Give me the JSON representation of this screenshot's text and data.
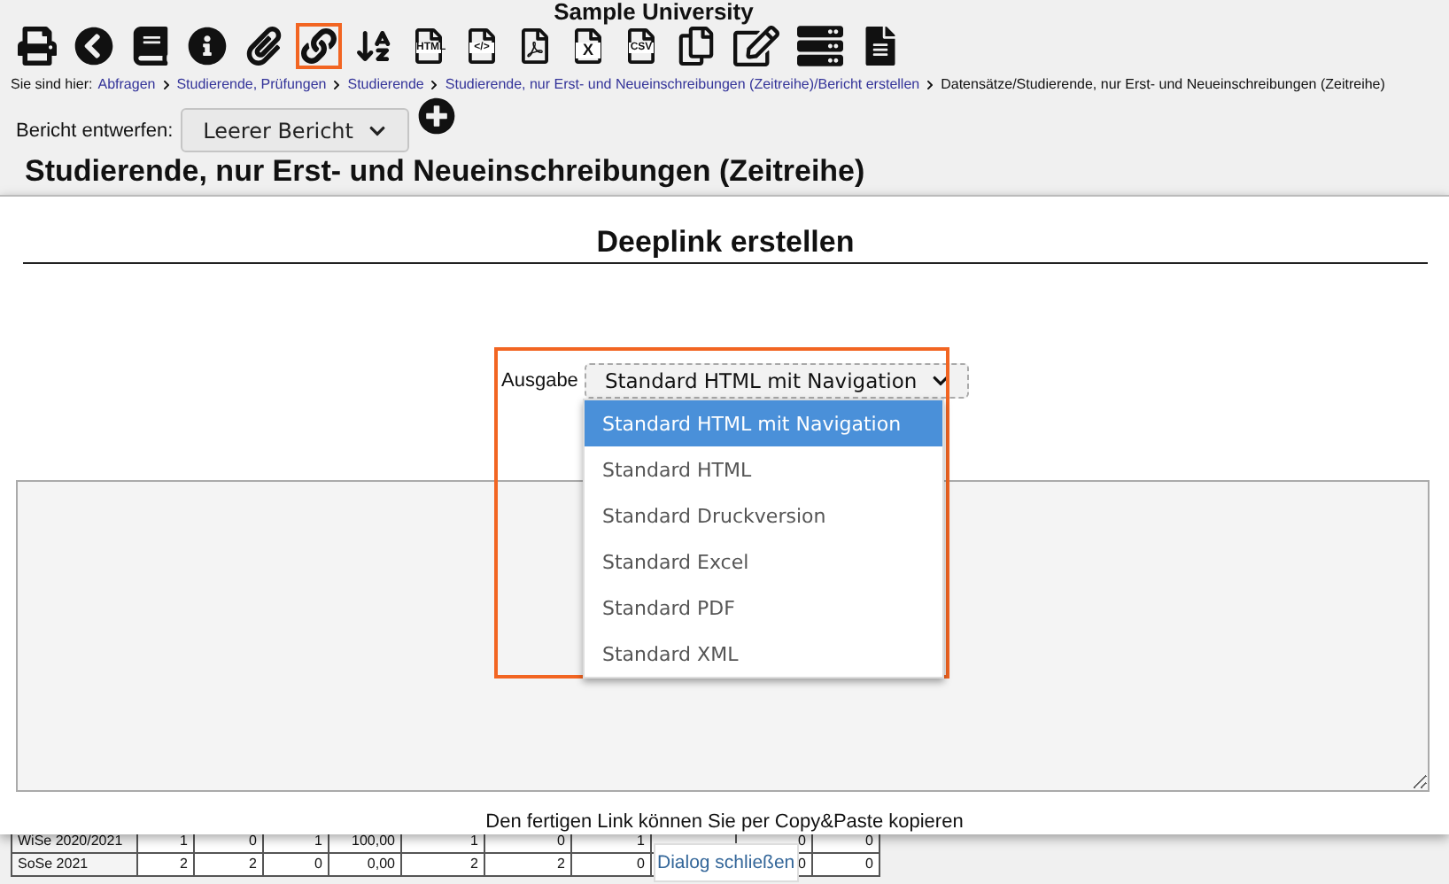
{
  "header": {
    "title": "Sample University"
  },
  "toolbar": [
    {
      "kind": "print",
      "highlighted": false
    },
    {
      "kind": "back",
      "highlighted": false
    },
    {
      "kind": "book",
      "highlighted": false
    },
    {
      "kind": "info",
      "highlighted": false
    },
    {
      "kind": "paperclip",
      "highlighted": false
    },
    {
      "kind": "link",
      "highlighted": true
    },
    {
      "kind": "sort",
      "highlighted": false
    },
    {
      "kind": "file",
      "label": "HTML",
      "highlighted": false
    },
    {
      "kind": "file",
      "label": "</>",
      "highlighted": false
    },
    {
      "kind": "pdf",
      "highlighted": false
    },
    {
      "kind": "file",
      "label": "X",
      "highlighted": false
    },
    {
      "kind": "file",
      "label": "CSV",
      "highlighted": false
    },
    {
      "kind": "copy",
      "highlighted": false
    },
    {
      "kind": "edit",
      "highlighted": false
    },
    {
      "kind": "list",
      "highlighted": false
    },
    {
      "kind": "document",
      "highlighted": false
    }
  ],
  "breadcrumb": {
    "prefix": "Sie sind hier:",
    "links": [
      "Abfragen",
      "Studierende, Prüfungen",
      "Studierende",
      "Studierende, nur Erst- und Neueinschreibungen (Zeitreihe)/Bericht erstellen"
    ],
    "current": "Datensätze/Studierende, nur Erst- und Neueinschreibungen (Zeitreihe)"
  },
  "report": {
    "label": "Bericht entwerfen:",
    "value": "Leerer Bericht"
  },
  "page_title": "Studierende, nur Erst- und Neueinschreibungen (Zeitreihe)",
  "table": {
    "rows": [
      {
        "cells": [
          "WiSe 2020/2021",
          "1",
          "0",
          "1",
          "100,00",
          "1",
          "0",
          "1",
          "0",
          "0"
        ]
      },
      {
        "cells": [
          "SoSe 2021",
          "2",
          "2",
          "0",
          "0,00",
          "2",
          "2",
          "0",
          "0",
          "0"
        ]
      }
    ]
  },
  "dialog": {
    "title": "Deeplink erstellen",
    "output": {
      "label": "Ausgabe",
      "value": "Standard HTML mit Navigation",
      "expanded": true,
      "highlighted": true,
      "options": [
        {
          "label": "Standard HTML mit Navigation",
          "selected": true
        },
        {
          "label": "Standard HTML",
          "selected": false
        },
        {
          "label": "Standard Druckversion",
          "selected": false
        },
        {
          "label": "Standard Excel",
          "selected": false
        },
        {
          "label": "Standard PDF",
          "selected": false
        },
        {
          "label": "Standard XML",
          "selected": false
        }
      ]
    },
    "hint": "Den fertigen Link können Sie per Copy&Paste kopieren",
    "close_button": "Dialog schließen"
  }
}
